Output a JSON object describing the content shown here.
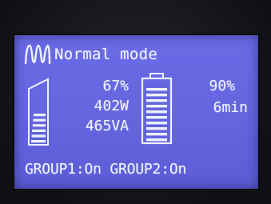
{
  "mode": {
    "text": "Normal mode",
    "icon": "sine-wave-icon"
  },
  "load": {
    "percent_text": "67%",
    "watts": "402W",
    "va": "465VA",
    "level": 0.67
  },
  "battery": {
    "percent_text": "90%",
    "runtime": "6min",
    "level": 0.9
  },
  "groups": {
    "text": "GROUP1:On GROUP2:On"
  },
  "colors": {
    "lcd_background": "#6566e0",
    "lcd_foreground": "#eef0ff",
    "bezel": "#16161b"
  }
}
